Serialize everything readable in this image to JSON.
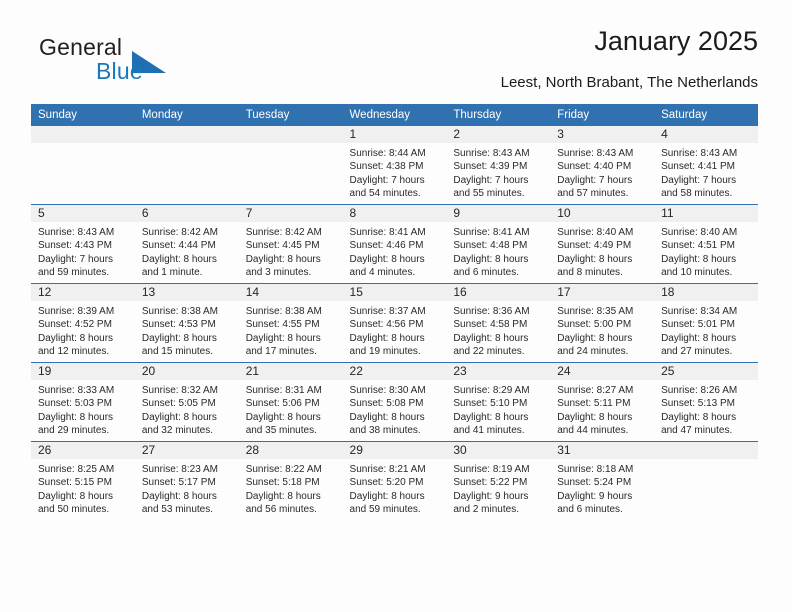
{
  "brand": {
    "name_part1": "General",
    "name_part2": "Blue",
    "triangle_color": "#1f6fb4",
    "blue_text_color": "#1878be"
  },
  "header": {
    "title": "January 2025",
    "subtitle": "Leest, North Brabant, The Netherlands"
  },
  "theme": {
    "header_blue": "#3071b0",
    "daynum_band_gray": "#f0f0f0",
    "page_background": "#fdfdfd",
    "text_color": "#1a1a1a"
  },
  "calendar": {
    "weekday_headers": [
      "Sunday",
      "Monday",
      "Tuesday",
      "Wednesday",
      "Thursday",
      "Friday",
      "Saturday"
    ],
    "weeks": [
      [
        {
          "day": "",
          "empty": true,
          "sunrise": "",
          "sunset": "",
          "daylight_line1": "",
          "daylight_line2": ""
        },
        {
          "day": "",
          "empty": true,
          "sunrise": "",
          "sunset": "",
          "daylight_line1": "",
          "daylight_line2": ""
        },
        {
          "day": "",
          "empty": true,
          "sunrise": "",
          "sunset": "",
          "daylight_line1": "",
          "daylight_line2": ""
        },
        {
          "day": "1",
          "empty": false,
          "sunrise": "Sunrise: 8:44 AM",
          "sunset": "Sunset: 4:38 PM",
          "daylight_line1": "Daylight: 7 hours",
          "daylight_line2": "and 54 minutes."
        },
        {
          "day": "2",
          "empty": false,
          "sunrise": "Sunrise: 8:43 AM",
          "sunset": "Sunset: 4:39 PM",
          "daylight_line1": "Daylight: 7 hours",
          "daylight_line2": "and 55 minutes."
        },
        {
          "day": "3",
          "empty": false,
          "sunrise": "Sunrise: 8:43 AM",
          "sunset": "Sunset: 4:40 PM",
          "daylight_line1": "Daylight: 7 hours",
          "daylight_line2": "and 57 minutes."
        },
        {
          "day": "4",
          "empty": false,
          "sunrise": "Sunrise: 8:43 AM",
          "sunset": "Sunset: 4:41 PM",
          "daylight_line1": "Daylight: 7 hours",
          "daylight_line2": "and 58 minutes."
        }
      ],
      [
        {
          "day": "5",
          "empty": false,
          "sunrise": "Sunrise: 8:43 AM",
          "sunset": "Sunset: 4:43 PM",
          "daylight_line1": "Daylight: 7 hours",
          "daylight_line2": "and 59 minutes."
        },
        {
          "day": "6",
          "empty": false,
          "sunrise": "Sunrise: 8:42 AM",
          "sunset": "Sunset: 4:44 PM",
          "daylight_line1": "Daylight: 8 hours",
          "daylight_line2": "and 1 minute."
        },
        {
          "day": "7",
          "empty": false,
          "sunrise": "Sunrise: 8:42 AM",
          "sunset": "Sunset: 4:45 PM",
          "daylight_line1": "Daylight: 8 hours",
          "daylight_line2": "and 3 minutes."
        },
        {
          "day": "8",
          "empty": false,
          "sunrise": "Sunrise: 8:41 AM",
          "sunset": "Sunset: 4:46 PM",
          "daylight_line1": "Daylight: 8 hours",
          "daylight_line2": "and 4 minutes."
        },
        {
          "day": "9",
          "empty": false,
          "sunrise": "Sunrise: 8:41 AM",
          "sunset": "Sunset: 4:48 PM",
          "daylight_line1": "Daylight: 8 hours",
          "daylight_line2": "and 6 minutes."
        },
        {
          "day": "10",
          "empty": false,
          "sunrise": "Sunrise: 8:40 AM",
          "sunset": "Sunset: 4:49 PM",
          "daylight_line1": "Daylight: 8 hours",
          "daylight_line2": "and 8 minutes."
        },
        {
          "day": "11",
          "empty": false,
          "sunrise": "Sunrise: 8:40 AM",
          "sunset": "Sunset: 4:51 PM",
          "daylight_line1": "Daylight: 8 hours",
          "daylight_line2": "and 10 minutes."
        }
      ],
      [
        {
          "day": "12",
          "empty": false,
          "sunrise": "Sunrise: 8:39 AM",
          "sunset": "Sunset: 4:52 PM",
          "daylight_line1": "Daylight: 8 hours",
          "daylight_line2": "and 12 minutes."
        },
        {
          "day": "13",
          "empty": false,
          "sunrise": "Sunrise: 8:38 AM",
          "sunset": "Sunset: 4:53 PM",
          "daylight_line1": "Daylight: 8 hours",
          "daylight_line2": "and 15 minutes."
        },
        {
          "day": "14",
          "empty": false,
          "sunrise": "Sunrise: 8:38 AM",
          "sunset": "Sunset: 4:55 PM",
          "daylight_line1": "Daylight: 8 hours",
          "daylight_line2": "and 17 minutes."
        },
        {
          "day": "15",
          "empty": false,
          "sunrise": "Sunrise: 8:37 AM",
          "sunset": "Sunset: 4:56 PM",
          "daylight_line1": "Daylight: 8 hours",
          "daylight_line2": "and 19 minutes."
        },
        {
          "day": "16",
          "empty": false,
          "sunrise": "Sunrise: 8:36 AM",
          "sunset": "Sunset: 4:58 PM",
          "daylight_line1": "Daylight: 8 hours",
          "daylight_line2": "and 22 minutes."
        },
        {
          "day": "17",
          "empty": false,
          "sunrise": "Sunrise: 8:35 AM",
          "sunset": "Sunset: 5:00 PM",
          "daylight_line1": "Daylight: 8 hours",
          "daylight_line2": "and 24 minutes."
        },
        {
          "day": "18",
          "empty": false,
          "sunrise": "Sunrise: 8:34 AM",
          "sunset": "Sunset: 5:01 PM",
          "daylight_line1": "Daylight: 8 hours",
          "daylight_line2": "and 27 minutes."
        }
      ],
      [
        {
          "day": "19",
          "empty": false,
          "sunrise": "Sunrise: 8:33 AM",
          "sunset": "Sunset: 5:03 PM",
          "daylight_line1": "Daylight: 8 hours",
          "daylight_line2": "and 29 minutes."
        },
        {
          "day": "20",
          "empty": false,
          "sunrise": "Sunrise: 8:32 AM",
          "sunset": "Sunset: 5:05 PM",
          "daylight_line1": "Daylight: 8 hours",
          "daylight_line2": "and 32 minutes."
        },
        {
          "day": "21",
          "empty": false,
          "sunrise": "Sunrise: 8:31 AM",
          "sunset": "Sunset: 5:06 PM",
          "daylight_line1": "Daylight: 8 hours",
          "daylight_line2": "and 35 minutes."
        },
        {
          "day": "22",
          "empty": false,
          "sunrise": "Sunrise: 8:30 AM",
          "sunset": "Sunset: 5:08 PM",
          "daylight_line1": "Daylight: 8 hours",
          "daylight_line2": "and 38 minutes."
        },
        {
          "day": "23",
          "empty": false,
          "sunrise": "Sunrise: 8:29 AM",
          "sunset": "Sunset: 5:10 PM",
          "daylight_line1": "Daylight: 8 hours",
          "daylight_line2": "and 41 minutes."
        },
        {
          "day": "24",
          "empty": false,
          "sunrise": "Sunrise: 8:27 AM",
          "sunset": "Sunset: 5:11 PM",
          "daylight_line1": "Daylight: 8 hours",
          "daylight_line2": "and 44 minutes."
        },
        {
          "day": "25",
          "empty": false,
          "sunrise": "Sunrise: 8:26 AM",
          "sunset": "Sunset: 5:13 PM",
          "daylight_line1": "Daylight: 8 hours",
          "daylight_line2": "and 47 minutes."
        }
      ],
      [
        {
          "day": "26",
          "empty": false,
          "sunrise": "Sunrise: 8:25 AM",
          "sunset": "Sunset: 5:15 PM",
          "daylight_line1": "Daylight: 8 hours",
          "daylight_line2": "and 50 minutes."
        },
        {
          "day": "27",
          "empty": false,
          "sunrise": "Sunrise: 8:23 AM",
          "sunset": "Sunset: 5:17 PM",
          "daylight_line1": "Daylight: 8 hours",
          "daylight_line2": "and 53 minutes."
        },
        {
          "day": "28",
          "empty": false,
          "sunrise": "Sunrise: 8:22 AM",
          "sunset": "Sunset: 5:18 PM",
          "daylight_line1": "Daylight: 8 hours",
          "daylight_line2": "and 56 minutes."
        },
        {
          "day": "29",
          "empty": false,
          "sunrise": "Sunrise: 8:21 AM",
          "sunset": "Sunset: 5:20 PM",
          "daylight_line1": "Daylight: 8 hours",
          "daylight_line2": "and 59 minutes."
        },
        {
          "day": "30",
          "empty": false,
          "sunrise": "Sunrise: 8:19 AM",
          "sunset": "Sunset: 5:22 PM",
          "daylight_line1": "Daylight: 9 hours",
          "daylight_line2": "and 2 minutes."
        },
        {
          "day": "31",
          "empty": false,
          "sunrise": "Sunrise: 8:18 AM",
          "sunset": "Sunset: 5:24 PM",
          "daylight_line1": "Daylight: 9 hours",
          "daylight_line2": "and 6 minutes."
        },
        {
          "day": "",
          "empty": true,
          "sunrise": "",
          "sunset": "",
          "daylight_line1": "",
          "daylight_line2": ""
        }
      ]
    ]
  }
}
